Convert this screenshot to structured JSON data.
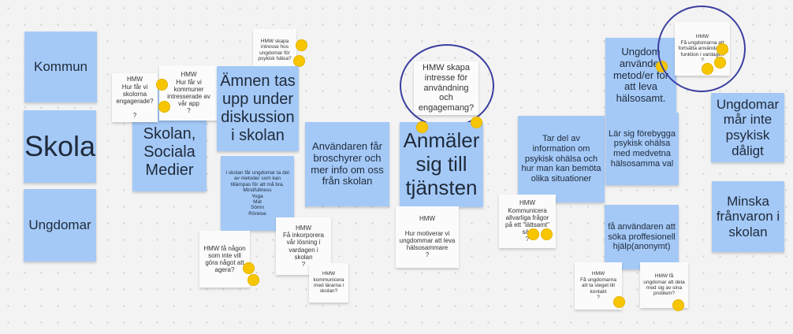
{
  "notes": {
    "kommun": "Kommun",
    "skola": "Skola",
    "ungdomar": "Ungdomar",
    "hmw_skolorna": "HMW\nHur får vi skolorna engagerade?\n\n?",
    "hmw_kommuner": "HMW\nHur får vi kommuner intresserade av vår app\n?",
    "skolan_sociala": "Skolan,\nSociala\nMedier",
    "hmw_psykisk": "HMW skapa intresse hos ungdomar för psykisk hälsa?",
    "amnen": "Ämnen tas upp under diskussion i skolan",
    "skolan_metoder": "I skolan får ungdomar ta del av metoder som kan tillämpas för att må bra.\nMindfullness\nYoga\nMat\nSömn\nRörelse",
    "hmw_agera": "HMW få någon som inte vill göra något att agera?",
    "hmw_inkorporera": "HMW\nFå inkorporera vår lösning i vardagen i skolan\n?",
    "hmw_lararna": "HMW\nkommunicera med lärarna i skolan?",
    "broschyrer": "Användaren får broschyrer och mer info om oss från skolan",
    "hmw_intresse": "HMW skapa intresse för användning och engagemang?",
    "anmaler": "Anmäler sig till tjänsten",
    "hmw_motiverar": "HMW\n\nHur motiverar vi ungdommar att leva hälsosammare\n?",
    "tar_del": "Tar del av information om psykisk ohälsa och hur man kan bemöta olika situationer",
    "hmw_allvarliga": "HMW\nKommunicera allvarliga frågor på ett \"lättsamt\" sätt\n?",
    "ungdom_metod": "Ungdom använder metod/er för att leva hälsosamt.",
    "hmw_fortsatta": "HMW\nFå ungdomarna att fortsätta använda vår funktion i vardagen\n?",
    "lar_sig": "Lär sig förebygga psykisk ohälsa med medvetna hälsosamma val",
    "ungdomar_mar": "Ungdomar mår inte psykisk dåligt",
    "minska": "Minska frånvaron i skolan",
    "fa_anvandaren": "få användaren att söka proffesionell hjälp(anonymt)",
    "hmw_steget": "HMW\nFå ungdomarna att ta steget till kontakt\n?",
    "hmw_dela": "HMW få ungdomar att dela med sig av sina problem?"
  },
  "colors": {
    "note_blue": "#a4c9f7",
    "note_white": "#fbfbfb",
    "dot_yellow": "#f7c600",
    "circle_outline": "#3b3fa0",
    "background": "#f3f3f3"
  }
}
